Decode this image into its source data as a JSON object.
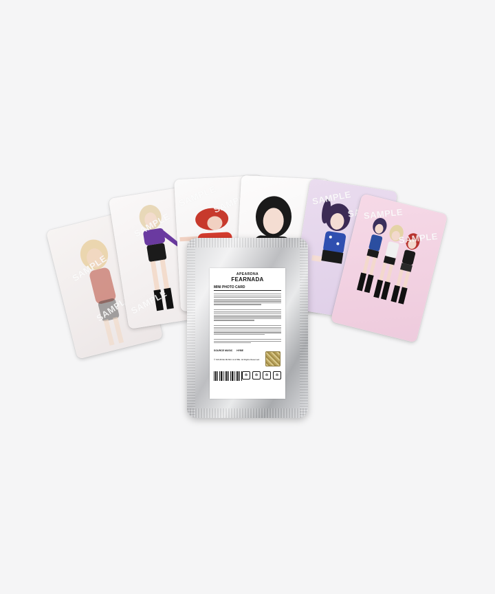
{
  "watermark": "SAMPLE",
  "package": {
    "logo_top": "APEARDNA",
    "logo_main": "FEARNADA",
    "product_title": "MINI PHOTO CARD",
    "copyright": "© SOURCE MUSIC & HYBE. All Rights Reserved.",
    "brand_1": "SOURCE MUSIC",
    "brand_2": "HYBE"
  },
  "colors": {
    "background": "#f5f5f6",
    "card_pink": "#f3d3e3",
    "card_lavender": "#e3d4ec",
    "hologram_gold": "#c2ad69"
  }
}
